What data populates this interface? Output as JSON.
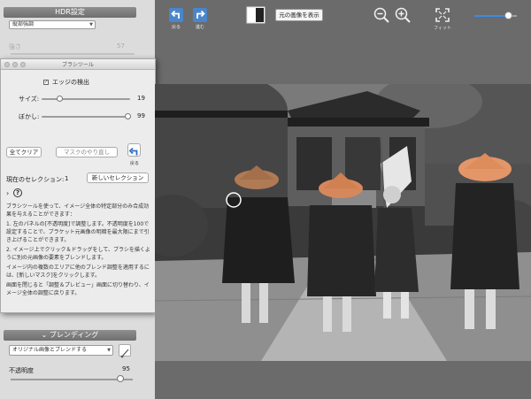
{
  "sidebar": {
    "hdr_title": "HDR設定",
    "preset_value": "縦部強調",
    "faded_label": "強さ",
    "faded_value": "57"
  },
  "brush_panel": {
    "title": "ブラシツール",
    "edge_detect_label": "エッジの検出",
    "size_label": "サイズ:",
    "size_value": "19",
    "size_fraction": 0.19,
    "blur_label": "ぼかし:",
    "blur_value": "99",
    "blur_fraction": 0.99,
    "clear_all_label": "全てクリア",
    "redo_mask_label": "マスクのやり直し",
    "undo_label": "戻る",
    "current_selection_label": "現在のセレクション:",
    "current_selection_value": "1",
    "new_selection_label": "新しいセレクション",
    "help": {
      "intro": "ブラシツールを使って、イメージ全体の特定部分のみ合成効果を与えることができます：",
      "step1": "1. 左のパネルの[不透明度]で調整します。不透明度を100で設定することで、ブラケット元画像の明暗を最大限にまで引き上げることができます。",
      "step2": "2. イメージ上でクリック＆ドラッグをして、ブラシを描くように別の元画像の要素をブレンドします。",
      "step3": "イメージ内の複数のエリアに他のブレンド調整を適用するには、[新しいマスク]をクリックします。",
      "step4": "画面を閉じると「調整＆プレビュー」画面に切り替わり、イメージ全体の調整に戻ります。"
    }
  },
  "blending": {
    "header": "ブレンディング",
    "mode_value": "オリジナル画像とブレンドする",
    "opacity_label": "不透明度",
    "opacity_value": "95",
    "opacity_fraction": 0.95
  },
  "toolbar": {
    "undo_label": "戻る",
    "redo_label": "進む",
    "show_original_label": "元の画像を表示",
    "fit_label": "フィット",
    "zoom_fraction": 0.8
  },
  "colors": {
    "accent": "#3b8be8",
    "undo_icon": "#2f6fc0",
    "background": "#6b6b6b"
  },
  "icons": [
    "undo-icon",
    "redo-icon",
    "compare-icon",
    "zoom-out-icon",
    "zoom-in-icon",
    "fit-icon",
    "help-icon",
    "brush-icon"
  ]
}
